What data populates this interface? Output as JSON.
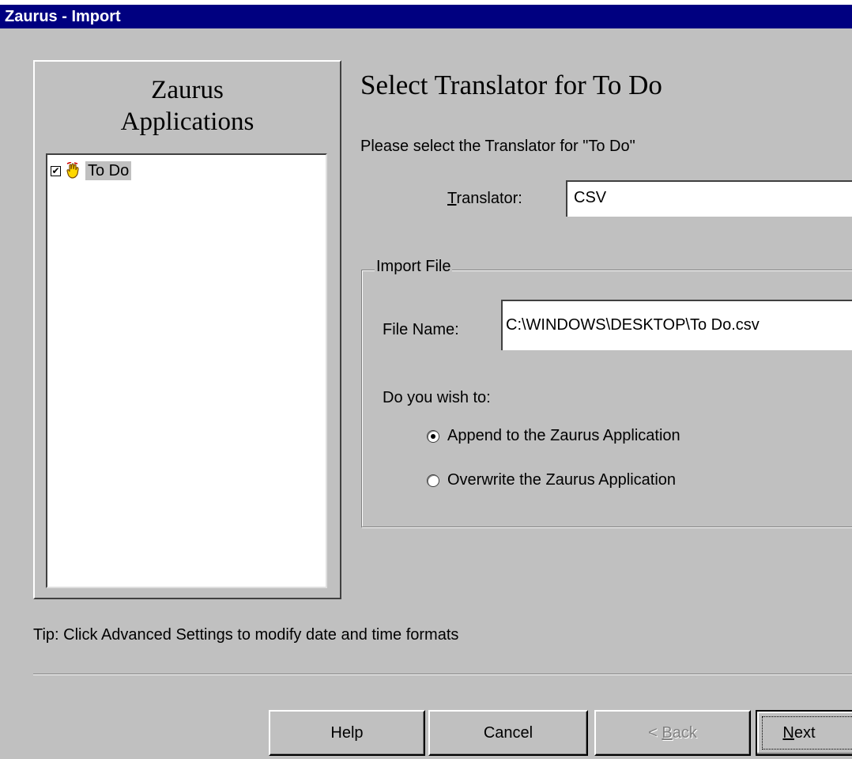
{
  "window": {
    "title": "Zaurus - Import"
  },
  "left_panel": {
    "title_line1": "Zaurus",
    "title_line2": "Applications",
    "items": [
      {
        "label": "To Do",
        "checked": true
      }
    ]
  },
  "main": {
    "heading": "Select Translator for To Do",
    "instruction": "Please select the Translator for  \"To Do\"",
    "translator_label_mnemonic": "T",
    "translator_label_rest": "ranslator:",
    "translator_value": "CSV",
    "import_group": {
      "legend": "Import File",
      "file_name_label": "File Name:",
      "file_name_value": "C:\\WINDOWS\\DESKTOP\\To Do.csv",
      "question": "Do you wish to:",
      "options": [
        {
          "label": "Append to the Zaurus Application",
          "selected": true
        },
        {
          "label": "Overwrite the  Zaurus Application",
          "selected": false
        }
      ]
    }
  },
  "tip": "Tip: Click Advanced Settings to modify date and time formats",
  "buttons": {
    "help": "Help",
    "cancel": "Cancel",
    "back_prefix": "< ",
    "back_mnemonic": "B",
    "back_rest": "ack",
    "next_mnemonic": "N",
    "next_rest": "ext"
  }
}
